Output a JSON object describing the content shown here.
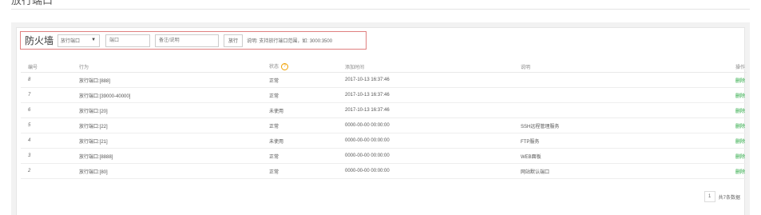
{
  "page": {
    "title": "放行端口"
  },
  "firewall": {
    "title": "防火墙",
    "select_value": "放行端口",
    "port_placeholder": "端口",
    "remark_placeholder": "备注/说明",
    "submit_label": "放行",
    "hint": "说明: 支持放行端口范围，如: 3000:3500"
  },
  "table": {
    "headers": {
      "id": "编号",
      "action": "行为",
      "status": "状态",
      "time": "添加时间",
      "desc": "说明",
      "op": "操作"
    },
    "rows": [
      {
        "id": "8",
        "action": "放行端口:[888]",
        "status": "正常",
        "time": "2017-10-13 16:37:46",
        "desc": "",
        "op": "删除"
      },
      {
        "id": "7",
        "action": "放行端口:[39000-40000]",
        "status": "正常",
        "time": "2017-10-13 16:37:46",
        "desc": "",
        "op": "删除"
      },
      {
        "id": "6",
        "action": "放行端口:[20]",
        "status": "未使用",
        "time": "2017-10-13 16:37:46",
        "desc": "",
        "op": "删除"
      },
      {
        "id": "5",
        "action": "放行端口:[22]",
        "status": "正常",
        "time": "0000-00-00 00:00:00",
        "desc": "SSH远程管理服务",
        "op": "删除"
      },
      {
        "id": "4",
        "action": "放行端口:[21]",
        "status": "未使用",
        "time": "0000-00-00 00:00:00",
        "desc": "FTP服务",
        "op": "删除"
      },
      {
        "id": "3",
        "action": "放行端口:[8888]",
        "status": "正常",
        "time": "0000-00-00 00:00:00",
        "desc": "WEB面板",
        "op": "删除"
      },
      {
        "id": "2",
        "action": "放行端口:[80]",
        "status": "正常",
        "time": "0000-00-00 00:00:00",
        "desc": "网站默认端口",
        "op": "删除"
      }
    ]
  },
  "pager": {
    "current": "1",
    "total": "共7条数据"
  },
  "colors": {
    "link": "#20a53a",
    "highlight_border": "#e08080",
    "help": "#f0a000"
  },
  "icons": {
    "help": "question-circle-icon",
    "caret": "caret-down-icon"
  }
}
